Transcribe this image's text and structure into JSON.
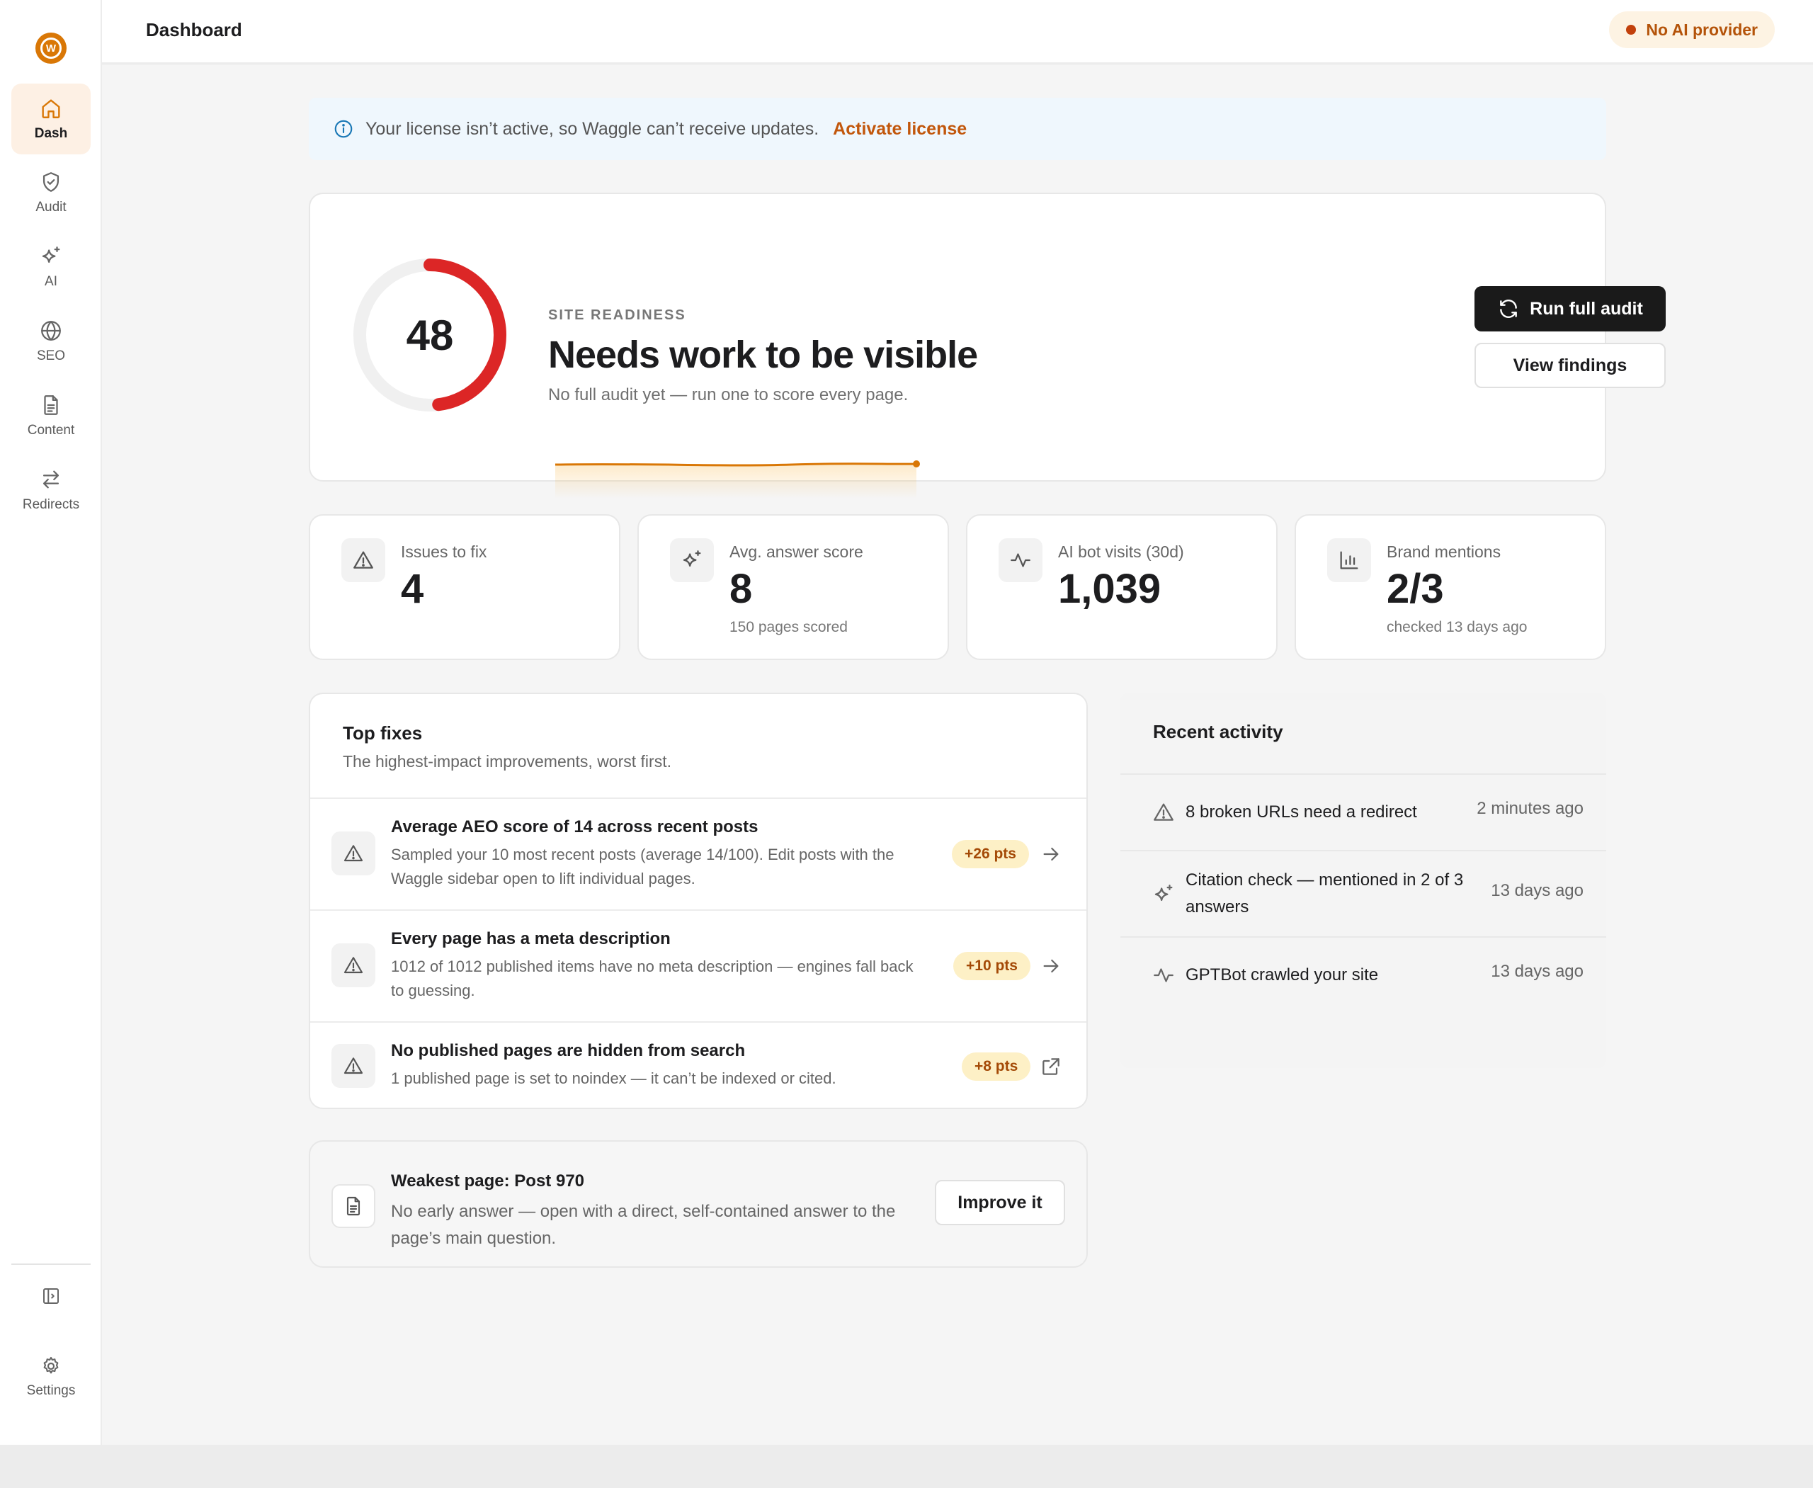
{
  "app": {
    "logo_letter": "W"
  },
  "colors": {
    "accent": "#d97706",
    "gauge_red": "#dc2626",
    "badge_text": "#b45309",
    "link": "#c2570c",
    "pts_bg": "#fdf0c6"
  },
  "sidebar": {
    "items": [
      {
        "label": "Dash",
        "icon": "home-icon",
        "active": true
      },
      {
        "label": "Audit",
        "icon": "shield-check-icon",
        "active": false
      },
      {
        "label": "AI",
        "icon": "sparkles-icon",
        "active": false
      },
      {
        "label": "SEO",
        "icon": "globe-icon",
        "active": false
      },
      {
        "label": "Content",
        "icon": "document-icon",
        "active": false
      },
      {
        "label": "Redirects",
        "icon": "arrows-swap-icon",
        "active": false
      }
    ],
    "collapse_icon": "sidebar-toggle-icon",
    "settings_label": "Settings"
  },
  "header": {
    "title": "Dashboard",
    "provider_status": "No AI provider"
  },
  "banner": {
    "message": "Your license isn’t active, so Waggle can’t receive updates.",
    "link": "Activate license"
  },
  "hero": {
    "score": "48",
    "score_value": 48,
    "score_max": 100,
    "label": "SITE READINESS",
    "title": "Needs work to be visible",
    "subtitle": "No full audit yet — run one to score every page.",
    "run_audit_label": "Run full audit",
    "view_findings_label": "View findings"
  },
  "stats": [
    {
      "label": "Issues to fix",
      "value": "4",
      "note": "",
      "icon": "warning-icon"
    },
    {
      "label": "Avg. answer score",
      "value": "8",
      "note": "150 pages scored",
      "icon": "sparkles-icon"
    },
    {
      "label": "AI bot visits (30d)",
      "value": "1,039",
      "note": "",
      "icon": "activity-icon"
    },
    {
      "label": "Brand mentions",
      "value": "2/3",
      "note": "checked 13 days ago",
      "icon": "bar-chart-icon"
    }
  ],
  "top_fixes": {
    "title": "Top fixes",
    "subtitle": "The highest-impact improvements, worst first.",
    "items": [
      {
        "title": "Average AEO score of 14 across recent posts",
        "desc": "Sampled your 10 most recent posts (average 14/100). Edit posts with the Waggle sidebar open to lift individual pages.",
        "pts": "+26 pts",
        "action_icon": "arrow-right-icon"
      },
      {
        "title": "Every page has a meta description",
        "desc": "1012 of 1012 published items have no meta description — engines fall back to guessing.",
        "pts": "+10 pts",
        "action_icon": "arrow-right-icon"
      },
      {
        "title": "No published pages are hidden from search",
        "desc": "1 published page is set to noindex — it can’t be indexed or cited.",
        "pts": "+8 pts",
        "action_icon": "external-link-icon"
      }
    ]
  },
  "weakest": {
    "title": "Weakest page: Post 970",
    "desc": "No early answer — open with a direct, self-contained answer to the page’s main question.",
    "button": "Improve it"
  },
  "activity": {
    "title": "Recent activity",
    "items": [
      {
        "text": "8 broken URLs need a redirect",
        "time": "2 minutes ago",
        "icon": "warning-icon"
      },
      {
        "text": "Citation check — mentioned in 2 of 3 answers",
        "time": "13 days ago",
        "icon": "sparkles-icon"
      },
      {
        "text": "GPTBot crawled your site",
        "time": "13 days ago",
        "icon": "activity-icon"
      }
    ]
  }
}
